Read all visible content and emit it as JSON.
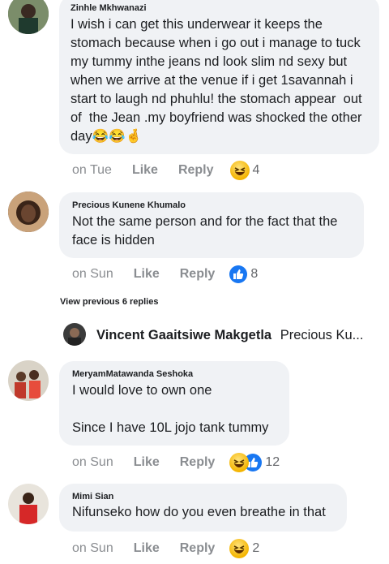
{
  "comments": [
    {
      "author": "Zinhle Mkhwanazi",
      "text": "I wish i can get this underwear it keeps the stomach because when i go out i manage to tuck my tummy inthe jeans nd look slim nd sexy but when we arrive at the venue if i get 1savannah i start to laugh nd phuhlu! the stomach appear  out of  the Jean .my boyfriend was shocked the other day😂😂🤞",
      "time": "on Tue",
      "like": "Like",
      "reply": "Reply",
      "reaction_count": "4",
      "reactions": [
        "haha-icon"
      ]
    },
    {
      "author": "Precious Kunene Khumalo",
      "text": "Not the same person and for the fact that the face is hidden",
      "time": "on Sun",
      "like": "Like",
      "reply": "Reply",
      "reaction_count": "8",
      "reactions": [
        "like-icon"
      ]
    },
    {
      "author": "MeryamMatawanda Seshoka",
      "text": "I would love to own one\n\nSince I have 10L jojo tank tummy",
      "time": "on Sun",
      "like": "Like",
      "reply": "Reply",
      "reaction_count": "12",
      "reactions": [
        "haha-icon",
        "like-icon"
      ]
    },
    {
      "author": "Mimi Sian",
      "text": "Nifunseko how do you even breathe in that",
      "time": "on Sun",
      "like": "Like",
      "reply": "Reply",
      "reaction_count": "2",
      "reactions": [
        "haha-icon"
      ]
    }
  ],
  "view_previous": "View previous 6 replies",
  "reply_preview": {
    "author": "Vincent Gaaitsiwe Makgetla",
    "snippet": "Precious Ku..."
  },
  "colors": {
    "bubble": "#f0f2f5",
    "muted": "#8a8d91",
    "like_blue": "#1877f2",
    "haha_yellow": "#f4b400"
  }
}
